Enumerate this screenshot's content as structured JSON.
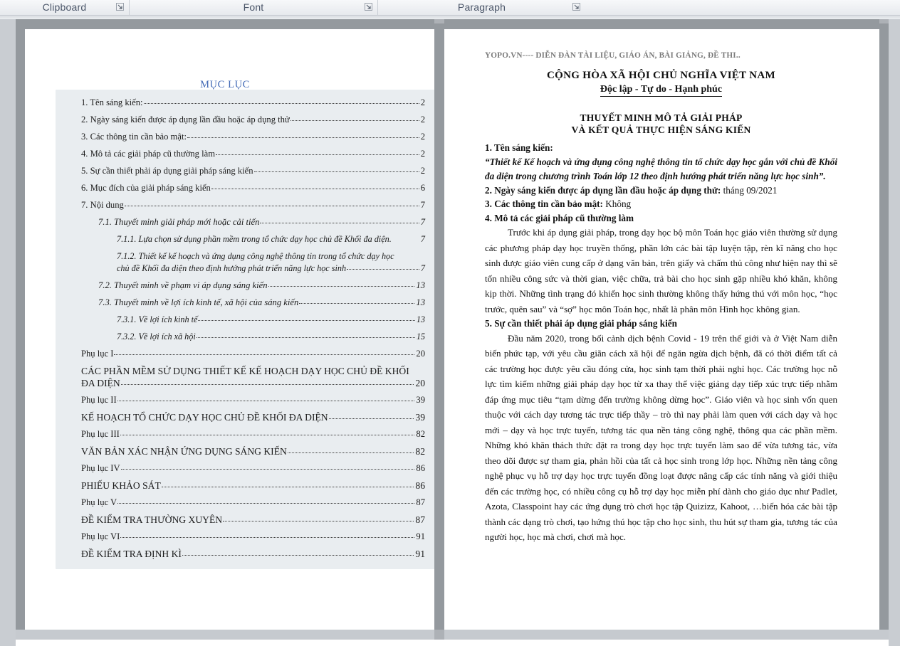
{
  "ribbon": {
    "groups": [
      {
        "label": "Clipboard",
        "launcher_icon": "dialog-launcher-icon"
      },
      {
        "label": "Font",
        "launcher_icon": "dialog-launcher-icon"
      },
      {
        "label": "Paragraph",
        "launcher_icon": "dialog-launcher-icon"
      }
    ]
  },
  "left_page": {
    "toc_title": "MỤC LỤC",
    "entries": [
      {
        "level": "lvl1",
        "text": "1.  Tên sáng kiến:",
        "page": "2"
      },
      {
        "level": "lvl1",
        "text": "2. Ngày sáng kiến được áp dụng lần đầu hoặc áp dụng thử",
        "page": "2"
      },
      {
        "level": "lvl1",
        "text": "3. Các thông tin cần bảo mật:",
        "page": "2"
      },
      {
        "level": "lvl1",
        "text": "4. Mô tả các giải pháp cũ thường làm",
        "page": "2"
      },
      {
        "level": "lvl1",
        "text": "5. Sự cần thiết phải áp dụng giải pháp sáng kiến",
        "page": "2"
      },
      {
        "level": "lvl1",
        "text": "6. Mục đích của giải pháp sáng kiến",
        "page": "6"
      },
      {
        "level": "lvl1",
        "text": "7. Nội dung",
        "page": "7"
      },
      {
        "level": "lvl2",
        "text": "7.1.  Thuyết minh giải pháp mới hoặc cải tiến",
        "page": "7"
      },
      {
        "level": "lvl3",
        "text": "7.1.1.  Lựa chọn sử dụng phần mềm trong tổ chức dạy học chủ đề Khối đa diện.",
        "page": "7",
        "nodots": true
      },
      {
        "level": "lvl3",
        "wrap": true,
        "line1": "7.1.2.  Thiết kế kế hoạch và ứng dụng công nghệ thông tin trong tổ chức dạy học",
        "text": "chủ đề Khối đa diện theo định hướng phát triển năng lực học sinh",
        "page": "7"
      },
      {
        "level": "lvl2",
        "text": "7.2.  Thuyết minh về phạm vi áp dụng sáng kiến",
        "page": "13"
      },
      {
        "level": "lvl2",
        "text": "7.3.  Thuyết minh về lợi ích kinh tế, xã hội của sáng kiến",
        "page": "13"
      },
      {
        "level": "lvl3",
        "text": "7.3.1.  Về lợi ích kinh tế",
        "page": "13"
      },
      {
        "level": "lvl3",
        "text": "7.3.2.  Về lợi ích xã hội",
        "page": "15"
      },
      {
        "level": "lvlp",
        "text": "Phụ lục I",
        "page": "20"
      },
      {
        "level": "lvlcap",
        "wrap": true,
        "line1": "CÁC PHẦN MỀM SỬ DỤNG THIẾT KẾ KẾ HOẠCH DẠY HỌC CHỦ ĐỀ KHỐI",
        "text": "ĐA DIỆN",
        "page": "20"
      },
      {
        "level": "lvlp",
        "text": "Phụ lục II",
        "page": "39"
      },
      {
        "level": "lvlcap",
        "text": "KẾ HOẠCH TỔ CHỨC DẠY HỌC CHỦ ĐỀ KHỐI ĐA DIỆN",
        "page": "39"
      },
      {
        "level": "lvlp",
        "text": "Phụ lục III",
        "page": "82"
      },
      {
        "level": "lvlcap",
        "text": "VĂN BẢN XÁC NHẬN ỨNG DỤNG SÁNG KIẾN",
        "page": "82"
      },
      {
        "level": "lvlp",
        "text": "Phụ lục IV",
        "page": "86"
      },
      {
        "level": "lvlcap",
        "text": "PHIẾU KHẢO SÁT",
        "page": "86"
      },
      {
        "level": "lvlp",
        "text": "Phụ lục V",
        "page": "87"
      },
      {
        "level": "lvlcap",
        "text": "ĐỀ KIỂM TRA THƯỜNG XUYÊN",
        "page": "87"
      },
      {
        "level": "lvlp",
        "text": "Phụ lục VI",
        "page": "91"
      },
      {
        "level": "lvlcap",
        "text": "ĐỀ KIỂM TRA ĐỊNH KÌ",
        "page": "91"
      }
    ]
  },
  "right_page": {
    "watermark": "YOPO.VN---- DIỄN ĐÀN TÀI LIỆU, GIÁO ÁN, BÀI GIẢNG, ĐỀ THI..",
    "nation": "CỘNG HÒA XÃ HỘI CHỦ NGHĨA VIỆT NAM",
    "motto": "Độc lập - Tự do - Hạnh phúc",
    "title_line1": "THUYẾT MINH MÔ TẢ GIẢI PHÁP",
    "title_line2": "VÀ KẾT QUẢ THỰC HIỆN SÁNG KIẾN",
    "h1": "1. Tên sáng kiến:",
    "quote": "“Thiết kế Kế hoạch và ứng dụng công nghệ thông tin tổ chức dạy học gắn với chủ đề Khối đa diện trong chương trình Toán lớp 12 theo định hướng phát triển năng lực học sinh”.",
    "h2_label": "2. Ngày sáng kiến được áp dụng lần đầu hoặc áp dụng thử:",
    "h2_value": " tháng 09/2021",
    "h3_label": "3. Các thông tin cần bảo mật:",
    "h3_value": " Không",
    "h4": "4. Mô tả các giải pháp cũ thường làm",
    "p4": "Trước khi áp dụng giải pháp, trong dạy học bộ môn Toán học giáo viên thường sử dụng các phương pháp dạy học truyền thống, phần lớn các bài tập luyện tập, rèn kĩ năng cho học sinh được giáo viên cung cấp ở dạng văn bản, trên giấy và chấm thủ công như hiện nay thì sẽ tốn nhiều công sức và thời gian, việc chữa, trả bài cho học sinh gặp nhiều khó khăn, không kịp thời. Những tình trạng đó khiến học sinh thường không thấy hứng thú với môn học, “học trước, quên sau” và “sợ” học môn Toán học, nhất là phân môn Hình học không gian.",
    "h5": "5. Sự cần thiết phải áp dụng giải pháp sáng kiến",
    "p5": "Đầu năm 2020, trong bối cảnh dịch bệnh Covid - 19 trên thế giới và ở Việt Nam diễn biến phức tạp, với yêu cầu giãn cách xã hội để ngăn ngừa dịch bệnh, đã có thời điểm tất cả các trường học được yêu cầu đóng cửa, học sinh tạm thời phải nghỉ học. Các trường học nỗ lực tìm kiếm những giải pháp dạy học từ xa thay thế việc giảng dạy tiếp xúc trực tiếp nhằm đáp ứng mục tiêu “tạm dừng đến trường không dừng học”. Giáo viên và học sinh vốn quen thuộc với cách dạy tương tác trực tiếp thầy – trò thì nay phải làm quen với cách dạy và học mới – dạy và học trực tuyến, tương tác qua nền tảng công nghệ, thông qua các phần mềm. Những khó khăn thách thức đặt ra trong dạy học trực tuyến làm sao để vừa tương tác, vừa theo dõi được sự tham gia, phản hồi của tất cả học sinh trong lớp học. Những nền tảng công nghệ phục vụ hỗ trợ dạy học trực tuyến đồng loạt được nâng cấp các tính năng và giới thiệu đến các trường học, có nhiều công cụ hỗ trợ dạy học miễn phí dành cho giáo dục như Padlet, Azota, Classpoint hay các ứng dụng trò chơi học tập Quizizz, Kahoot, …biến hóa các bài tập thành các dạng trò chơi, tạo hứng thú học tập cho học sinh, thu hút sự tham gia, tương tác của người học, học mà chơi, chơi mà học."
  },
  "colors": {
    "toc_title": "#4169b5",
    "toc_shading": "#e9edf0",
    "frame_gray": "#94999e",
    "workspace_gray": "#c6cacf"
  }
}
